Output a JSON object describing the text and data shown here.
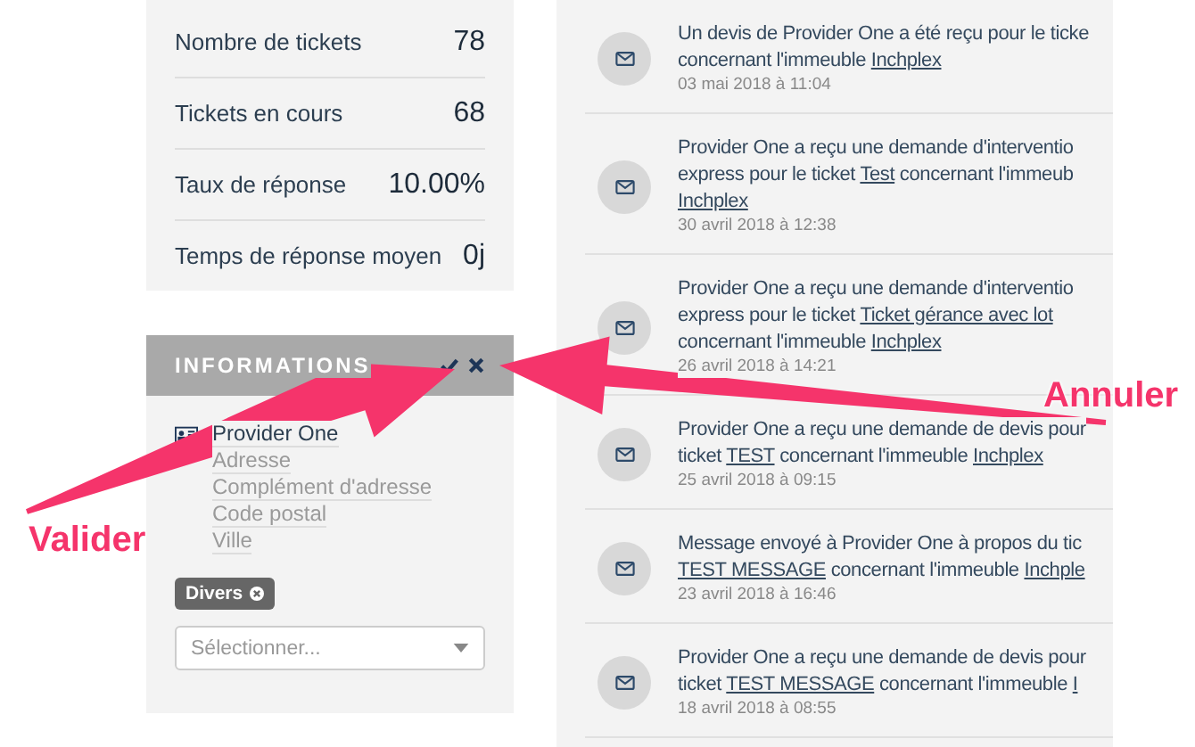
{
  "stats": [
    {
      "label": "Nombre de tickets",
      "value": "78"
    },
    {
      "label": "Tickets en cours",
      "value": "68"
    },
    {
      "label": "Taux de réponse",
      "value": "10.00%"
    },
    {
      "label": "Temps de réponse moyen",
      "value": "0j"
    }
  ],
  "informations": {
    "title": "INFORMATIONS",
    "name": "Provider One",
    "address_fields": [
      {
        "placeholder": "Adresse"
      },
      {
        "placeholder": "Complément d'adresse"
      },
      {
        "placeholder": "Code postal"
      },
      {
        "placeholder": "Ville"
      }
    ],
    "tags": [
      {
        "label": "Divers"
      }
    ],
    "select": {
      "placeholder": "Sélectionner..."
    }
  },
  "messages": [
    {
      "lines": [
        [
          {
            "text": "Un devis de Provider One a été reçu pour le ticke",
            "link": false
          }
        ],
        [
          {
            "text": "concernant l'immeuble ",
            "link": false
          },
          {
            "text": "Inchplex",
            "link": true
          }
        ]
      ],
      "date": "03 mai 2018 à 11:04"
    },
    {
      "lines": [
        [
          {
            "text": "Provider One a reçu une demande d'interventio",
            "link": false
          }
        ],
        [
          {
            "text": "express pour le ticket ",
            "link": false
          },
          {
            "text": "Test",
            "link": true
          },
          {
            "text": " concernant l'immeub",
            "link": false
          }
        ],
        [
          {
            "text": "Inchplex",
            "link": true
          }
        ]
      ],
      "date": "30 avril 2018 à 12:38"
    },
    {
      "lines": [
        [
          {
            "text": "Provider One a reçu une demande d'interventio",
            "link": false
          }
        ],
        [
          {
            "text": "express pour le ticket ",
            "link": false
          },
          {
            "text": "Ticket gérance avec lot",
            "link": true
          }
        ],
        [
          {
            "text": "concernant l'immeuble ",
            "link": false
          },
          {
            "text": "Inchplex",
            "link": true
          }
        ]
      ],
      "date": "26 avril 2018 à 14:21"
    },
    {
      "lines": [
        [
          {
            "text": "Provider One a reçu une demande de devis pour",
            "link": false
          }
        ],
        [
          {
            "text": "ticket ",
            "link": false
          },
          {
            "text": "TEST",
            "link": true
          },
          {
            "text": " concernant l'immeuble ",
            "link": false
          },
          {
            "text": "Inchplex",
            "link": true
          }
        ]
      ],
      "date": "25 avril 2018 à 09:15"
    },
    {
      "lines": [
        [
          {
            "text": "Message envoyé à Provider One à propos du tic",
            "link": false
          }
        ],
        [
          {
            "text": "TEST MESSAGE",
            "link": true
          },
          {
            "text": " concernant l'immeuble ",
            "link": false
          },
          {
            "text": "Inchple",
            "link": true
          }
        ]
      ],
      "date": "23 avril 2018 à 16:46"
    },
    {
      "lines": [
        [
          {
            "text": "Provider One a reçu une demande de devis pour",
            "link": false
          }
        ],
        [
          {
            "text": "ticket ",
            "link": false
          },
          {
            "text": "TEST MESSAGE",
            "link": true
          },
          {
            "text": " concernant l'immeuble ",
            "link": false
          },
          {
            "text": "I",
            "link": true
          }
        ]
      ],
      "date": "18 avril 2018 à 08:55"
    }
  ],
  "annotations": [
    {
      "label": "Valider"
    },
    {
      "label": "Annuler"
    }
  ]
}
